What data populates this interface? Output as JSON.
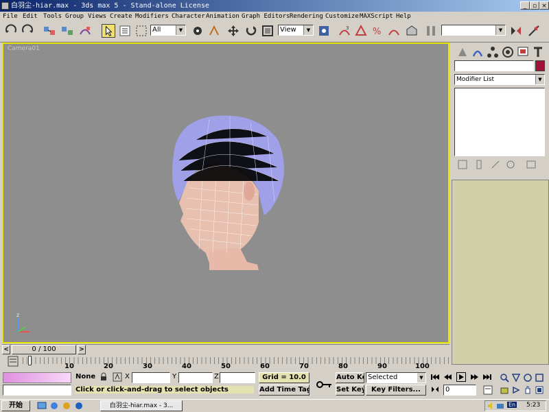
{
  "window": {
    "title": "白羽尘-hiar.max - 3ds max 5 - Stand-alone License",
    "controls": [
      "_",
      "▫",
      "×"
    ]
  },
  "menu": [
    "File",
    "Edit",
    "Tools",
    "Group",
    "Views",
    "Create",
    "Modifiers",
    "Character",
    "Animation",
    "Graph Editors",
    "Rendering",
    "Customize",
    "MAXScript",
    "Help"
  ],
  "toolbar": {
    "selection_filter": "All",
    "ref_coord": "View"
  },
  "viewport": {
    "label": "Camera01",
    "axis_label": "z"
  },
  "command_panel": {
    "name_value": "",
    "color_swatch": "#a0143c",
    "modifier_list": "Modifier List"
  },
  "time": {
    "slider_label": "0 / 100",
    "ticks": [
      "10",
      "20",
      "30",
      "40",
      "50",
      "60",
      "70",
      "80",
      "90",
      "100"
    ]
  },
  "status": {
    "selection": "None",
    "x_label": "X",
    "y_label": "Y",
    "z_label": "Z",
    "x_value": "",
    "y_value": "",
    "z_value": "",
    "grid": "Grid = 10.0",
    "prompt": "Click or click-and-drag to select objects",
    "add_time_tag": "Add Time Tag",
    "auto_key": "Auto Key",
    "set_key": "Set Key",
    "key_mode": "Selected",
    "key_filters": "Key Filters...",
    "frame": "0"
  },
  "taskbar": {
    "start": "开始",
    "task": "白羽尘-hiar.max - 3...",
    "lang": "En",
    "clock": "5:23"
  },
  "colors": {
    "accent": "#0a246a",
    "viewport_border": "#e6e600",
    "viewport_bg": "#8e8e8e",
    "hair": "#a0a0e8",
    "skin": "#e8c8b8"
  }
}
